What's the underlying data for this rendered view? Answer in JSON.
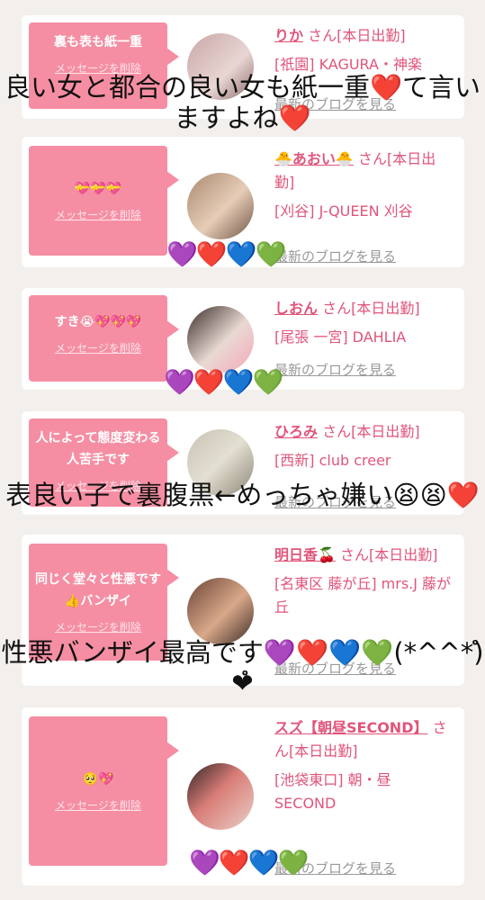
{
  "cards": [
    {
      "message": "裏も表も紙一重",
      "delete_label": "メッセージを削除",
      "name": "りか",
      "san": "さん[本日出勤]",
      "location": "[祇園] KAGURA・神楽",
      "blog": "最新のブログを見る"
    },
    {
      "message": "💝💝💝",
      "delete_label": "メッセージを削除",
      "name": "🐣あおい🐣",
      "san": "さん[本日出勤]",
      "location": "[刈谷] J-QUEEN 刈谷",
      "blog": "最新のブログを見る"
    },
    {
      "message": "すき😭💖💖💖",
      "delete_label": "メッセージを削除",
      "name": "しおん",
      "san": "さん[本日出勤]",
      "location": "[尾張 一宮] DAHLIA",
      "blog": "最新のブログを見る"
    },
    {
      "message": "人によって態度変わる人苦手です",
      "delete_label": "メッセージを削除",
      "name": "ひろみ",
      "san": "さん[本日出勤]",
      "location": "[西新] club creer",
      "blog": "最新のブログを見る"
    },
    {
      "message": "同じく堂々と性悪です👍バンザイ",
      "delete_label": "メッセージを削除",
      "name": "明日香🍒",
      "san": "さん[本日出勤]",
      "location": "[名東区 藤が丘] mrs.J 藤が丘",
      "blog": "最新のブログを見る"
    },
    {
      "message": "🥺💖",
      "delete_label": "メッセージを削除",
      "name": "スズ【朝昼SECOND】",
      "san": "さん[本日出勤]",
      "location": "[池袋東口] 朝・昼 SECOND",
      "blog": "最新のブログを見る"
    }
  ],
  "overlays": {
    "top": "良い女と都合の良い女も紙一重❤️て言いますよね❤️",
    "middle": "表良い子で裏腹黒←めっちゃ嫌い😫😫❤️",
    "lower": "性悪バンザイ最高です💜❤️💙💚(*^^*)ໍ❤︎ໍ"
  },
  "hearts": "💜❤️💙💚"
}
